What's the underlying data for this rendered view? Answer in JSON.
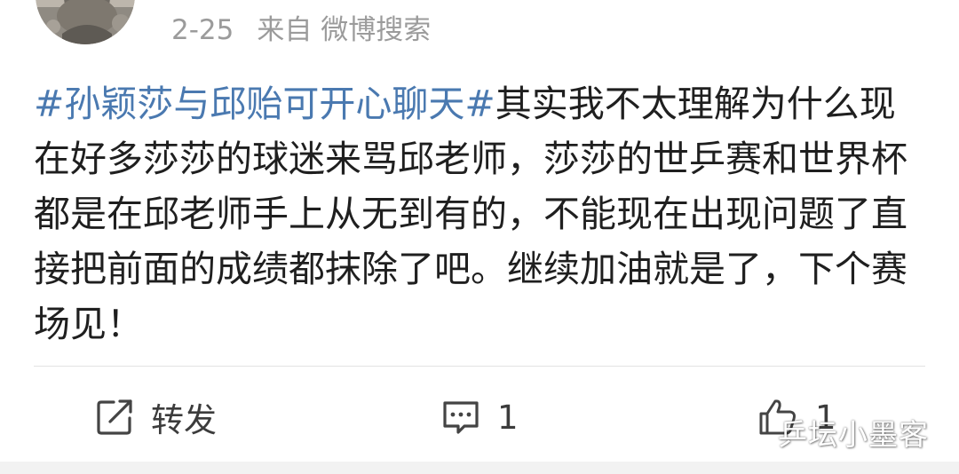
{
  "post": {
    "date": "2-25",
    "source": "来自 微博搜索",
    "topic": "#孙颖莎与邱贻可开心聊天#",
    "body": "其实我不太理解为什么现在好多莎莎的球迷来骂邱老师，莎莎的世乒赛和世界杯都是在邱老师手上从无到有的，不能现在出现问题了直接把前面的成绩都抹除了吧。继续加油就是了，下个赛场见！"
  },
  "actions": {
    "forward": {
      "label": "转发",
      "icon": "share-icon"
    },
    "comment": {
      "count": "1",
      "icon": "comment-icon"
    },
    "like": {
      "count": "1",
      "icon": "thumbs-up-icon"
    }
  },
  "watermark": "乒坛小墨客",
  "colors": {
    "topic_link": "#4a79b0",
    "meta_text": "#9b9b9b",
    "body_text": "#1f1f1f"
  }
}
